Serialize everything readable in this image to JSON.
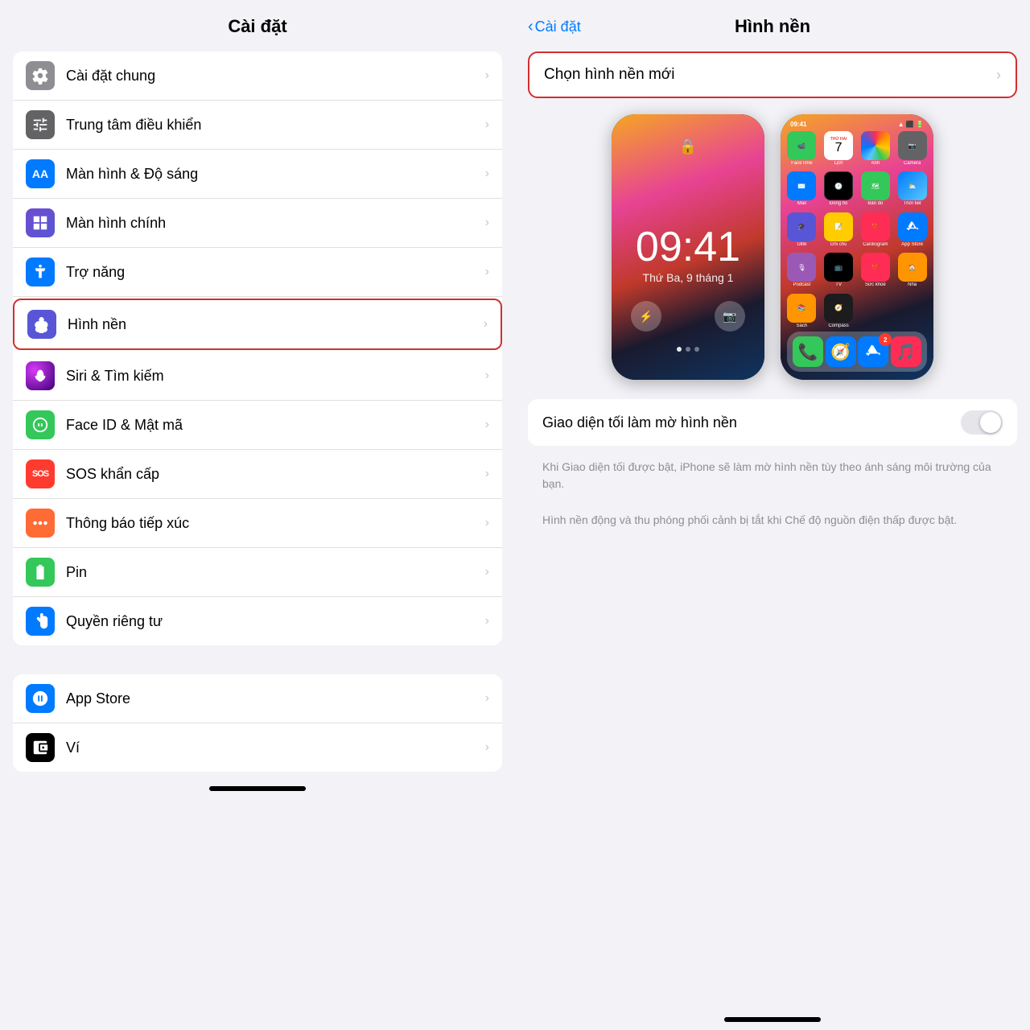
{
  "left": {
    "title": "Cài đặt",
    "items": [
      {
        "id": "cai-dat-chung",
        "label": "Cài đặt chung",
        "icon_color": "gray",
        "icon_type": "gear"
      },
      {
        "id": "trung-tam-dieu-khien",
        "label": "Trung tâm điều khiển",
        "icon_color": "gray2",
        "icon_type": "sliders"
      },
      {
        "id": "man-hinh-do-sang",
        "label": "Màn hình & Độ sáng",
        "icon_color": "blue",
        "icon_type": "aa"
      },
      {
        "id": "man-hinh-chinh",
        "label": "Màn hình chính",
        "icon_color": "blue2",
        "icon_type": "grid"
      },
      {
        "id": "tro-nang",
        "label": "Trợ năng",
        "icon_color": "blue2",
        "icon_type": "accessibility"
      },
      {
        "id": "hinh-nen",
        "label": "Hình nền",
        "icon_color": "flower",
        "icon_type": "flower",
        "highlighted": true
      },
      {
        "id": "siri-tim-kiem",
        "label": "Siri & Tìm kiếm",
        "icon_color": "siri",
        "icon_type": "siri"
      },
      {
        "id": "face-id-mat-ma",
        "label": "Face ID & Mật mã",
        "icon_color": "green",
        "icon_type": "faceid"
      },
      {
        "id": "sos-khan-cap",
        "label": "SOS khẩn cấp",
        "icon_color": "red",
        "icon_type": "sos"
      },
      {
        "id": "thong-bao-tiep-xuc",
        "label": "Thông báo tiếp xúc",
        "icon_color": "orange-red",
        "icon_type": "dots"
      },
      {
        "id": "pin",
        "label": "Pin",
        "icon_color": "battery",
        "icon_type": "battery"
      },
      {
        "id": "quyen-rieng-tu",
        "label": "Quyền riêng tư",
        "icon_color": "hand",
        "icon_type": "hand"
      }
    ],
    "items2": [
      {
        "id": "app-store",
        "label": "App Store",
        "icon_color": "appstore",
        "icon_type": "appstore"
      },
      {
        "id": "vi",
        "label": "Ví",
        "icon_color": "wallet",
        "icon_type": "wallet"
      }
    ]
  },
  "right": {
    "back_label": "Cài đặt",
    "title": "Hình nền",
    "choose_label": "Chọn hình nền mới",
    "lock_time": "09:41",
    "lock_date": "Thứ Ba, 9 tháng 1",
    "toggle_label": "Giao diện tối làm mờ hình nền",
    "hint1": "Khi Giao diện tối được bật, iPhone sẽ làm mờ hình nền tùy theo ánh sáng môi trường của bạn.",
    "hint2": "Hình nền động và thu phóng phối cảnh bị tắt khi Chế độ nguồn điện thấp được bật.",
    "home_apps": [
      {
        "name": "FaceTime",
        "bg": "#34c759"
      },
      {
        "name": "Lịch",
        "bg": "#ff3b30"
      },
      {
        "name": "Ảnh",
        "bg": "#ff9500"
      },
      {
        "name": "Camera",
        "bg": "#636366"
      },
      {
        "name": "Mail",
        "bg": "#007aff"
      },
      {
        "name": "Đồng hồ",
        "bg": "#000"
      },
      {
        "name": "Bản đồ",
        "bg": "#34c759"
      },
      {
        "name": "Thời tiết",
        "bg": "#007aff"
      },
      {
        "name": "Ulife",
        "bg": "#5856d6"
      },
      {
        "name": "Ghi chú",
        "bg": "#ffcc00"
      },
      {
        "name": "Cardiogram",
        "bg": "#ff2d55"
      },
      {
        "name": "App Store",
        "bg": "#007aff"
      },
      {
        "name": "Podcast",
        "bg": "#9b59b6"
      },
      {
        "name": "Apple TV",
        "bg": "#000"
      },
      {
        "name": "Health",
        "bg": "#ff2d55"
      },
      {
        "name": "Home",
        "bg": "#ff9500"
      },
      {
        "name": "Sách",
        "bg": "#ff9500"
      },
      {
        "name": "Compass",
        "bg": "#636366"
      }
    ],
    "dock_apps": [
      {
        "name": "Phone",
        "bg": "#34c759"
      },
      {
        "name": "Safari",
        "bg": "#007aff"
      },
      {
        "name": "App Store",
        "bg": "#007aff"
      },
      {
        "name": "Music",
        "bg": "#ff2d55"
      }
    ]
  }
}
